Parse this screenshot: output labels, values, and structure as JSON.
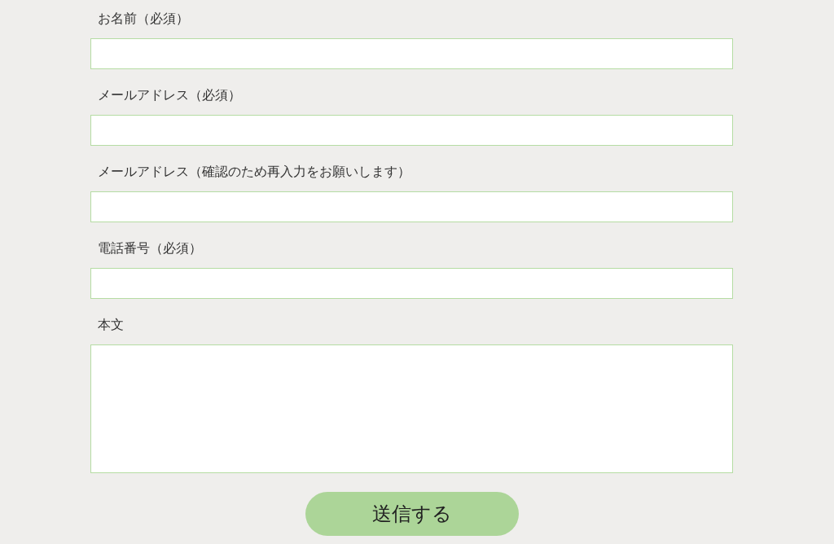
{
  "fields": [
    {
      "label": "お名前（必須）",
      "kind": "input"
    },
    {
      "label": "メールアドレス（必須）",
      "kind": "input"
    },
    {
      "label": "メールアドレス（確認のため再入力をお願いします）",
      "kind": "input"
    },
    {
      "label": "電話番号（必須）",
      "kind": "input"
    },
    {
      "label": "本文",
      "kind": "textarea"
    }
  ],
  "submit_button": {
    "label": "送信する"
  }
}
